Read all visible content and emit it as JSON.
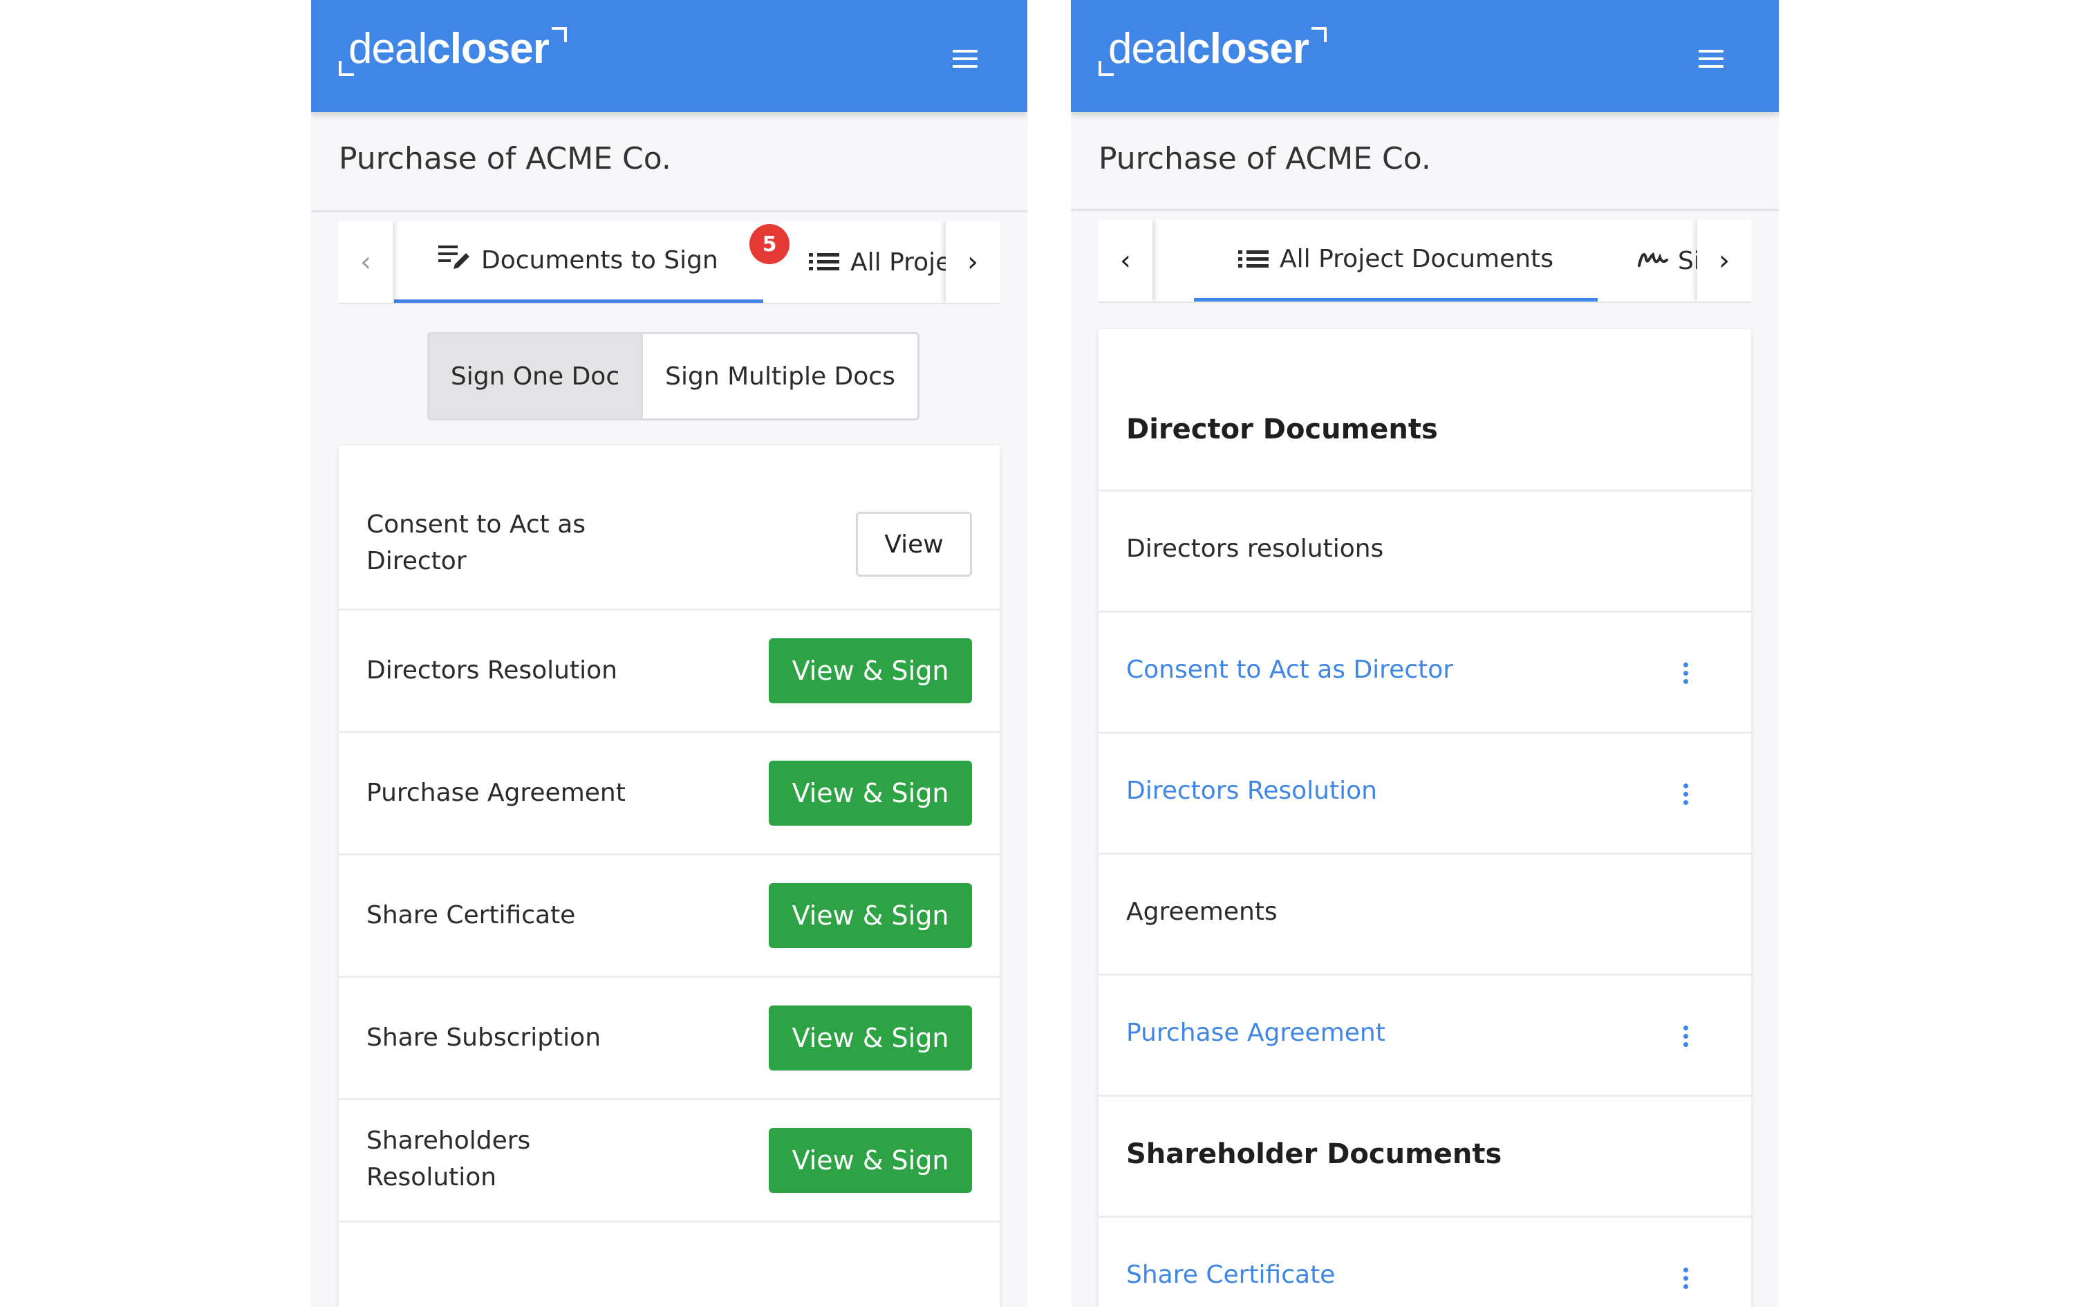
{
  "app": {
    "logo_light": "deal",
    "logo_bold": "closer",
    "menu_icon": "hamburger-menu-icon",
    "brand_color": "#3f86e6",
    "accent_green": "#2ea345",
    "badge_red": "#e53935"
  },
  "left_screen": {
    "page_title": "Purchase of ACME Co.",
    "tabs": [
      {
        "label": "Documents to Sign",
        "icon": "edit-list-icon",
        "badge": "5",
        "active": true
      },
      {
        "label": "All Proje",
        "icon": "list-icon",
        "active": false
      }
    ],
    "segmented": {
      "option1": "Sign One Doc",
      "option2": "Sign Multiple Docs",
      "selected": "Sign One Doc"
    },
    "documents": [
      {
        "name_line1": "Consent to Act as",
        "name_line2": "Director",
        "action": "View"
      },
      {
        "name": "Directors Resolution",
        "action": "View & Sign"
      },
      {
        "name": "Purchase Agreement",
        "action": "View & Sign"
      },
      {
        "name": "Share Certificate",
        "action": "View & Sign"
      },
      {
        "name": "Share Subscription",
        "action": "View & Sign"
      },
      {
        "name_line1": "Shareholders",
        "name_line2": "Resolution",
        "action": "View & Sign"
      }
    ]
  },
  "right_screen": {
    "page_title": "Purchase of ACME Co.",
    "tabs": [
      {
        "label": "All Project Documents",
        "icon": "list-icon",
        "active": true
      },
      {
        "label": "Si",
        "icon": "signature-icon",
        "active": false
      }
    ],
    "sections": {
      "director_heading": "Director Documents",
      "group_directors_resolutions": "Directors resolutions",
      "consent": "Consent to Act as Director",
      "directors_resolution": "Directors Resolution",
      "group_agreements": "Agreements",
      "purchase_agreement": "Purchase Agreement",
      "shareholder_heading": "Shareholder Documents",
      "share_certificate": "Share Certificate"
    }
  }
}
